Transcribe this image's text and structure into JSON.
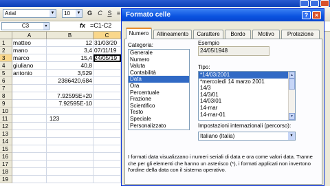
{
  "toolbar": {
    "font": "Arial",
    "size": "10",
    "icons": [
      "bold-icon",
      "italic-icon",
      "underline-icon",
      "align-left-icon"
    ]
  },
  "formula_bar": {
    "name_box": "C3",
    "fx": "fx",
    "formula": "=C1-C2"
  },
  "sheet": {
    "columns": [
      "A",
      "B",
      "C"
    ],
    "rows": [
      {
        "n": "1",
        "a": "matteo",
        "b": "12",
        "c": "31/03/20"
      },
      {
        "n": "2",
        "a": "mano",
        "b": "3,4",
        "c": "07/11/19"
      },
      {
        "n": "3",
        "a": "marco",
        "b": "15,4",
        "c": "24/05/19"
      },
      {
        "n": "4",
        "a": "giuliano",
        "b": "40,8",
        "c": ""
      },
      {
        "n": "5",
        "a": "antonio",
        "b": "3,529",
        "c": ""
      },
      {
        "n": "6",
        "a": "",
        "b": "2386420,684",
        "c": ""
      },
      {
        "n": "7",
        "a": "",
        "b": "",
        "c": ""
      },
      {
        "n": "8",
        "a": "",
        "b": "7.92595E+20",
        "c": ""
      },
      {
        "n": "9",
        "a": "",
        "b": "7.92595E-10",
        "c": ""
      },
      {
        "n": "10",
        "a": "",
        "b": "",
        "c": ""
      },
      {
        "n": "11",
        "a": "",
        "b": "123",
        "c": ""
      },
      {
        "n": "12",
        "a": "",
        "b": "",
        "c": ""
      },
      {
        "n": "13",
        "a": "",
        "b": "",
        "c": ""
      },
      {
        "n": "14",
        "a": "",
        "b": "",
        "c": ""
      },
      {
        "n": "15",
        "a": "",
        "b": "",
        "c": ""
      },
      {
        "n": "16",
        "a": "",
        "b": "",
        "c": ""
      },
      {
        "n": "17",
        "a": "",
        "b": "",
        "c": ""
      },
      {
        "n": "18",
        "a": "",
        "b": "",
        "c": ""
      },
      {
        "n": "19",
        "a": "",
        "b": "",
        "c": ""
      },
      {
        "n": "20",
        "a": "",
        "b": "",
        "c": ""
      }
    ]
  },
  "dialog": {
    "title": "Formato celle",
    "tabs": [
      "Numero",
      "Allineamento",
      "Carattere",
      "Bordo",
      "Motivo",
      "Protezione"
    ],
    "categoria_label": "Categoria:",
    "categorie": [
      "Generale",
      "Numero",
      "Valuta",
      "Contabilità",
      "Data",
      "Ora",
      "Percentuale",
      "Frazione",
      "Scientifico",
      "Testo",
      "Speciale",
      "Personalizzato"
    ],
    "esempio_label": "Esempio",
    "esempio_value": "24/05/1948",
    "tipo_label": "Tipo:",
    "tipi": [
      "*14/03/2001",
      "*mercoledì 14 marzo 2001",
      "14/3",
      "14/3/01",
      "14/03/01",
      "14-mar",
      "14-mar-01"
    ],
    "impostazioni_label": "Impostazioni internazionali (percorso):",
    "impostazioni_value": "Italiano (Italia)",
    "description": "I formati data visualizzano i numeri seriali di data e ora come valori data. Tranne che per gli elementi che hanno un asterisco (*), i formati applicati non invertono l'ordine della data con il sistema operativo."
  }
}
